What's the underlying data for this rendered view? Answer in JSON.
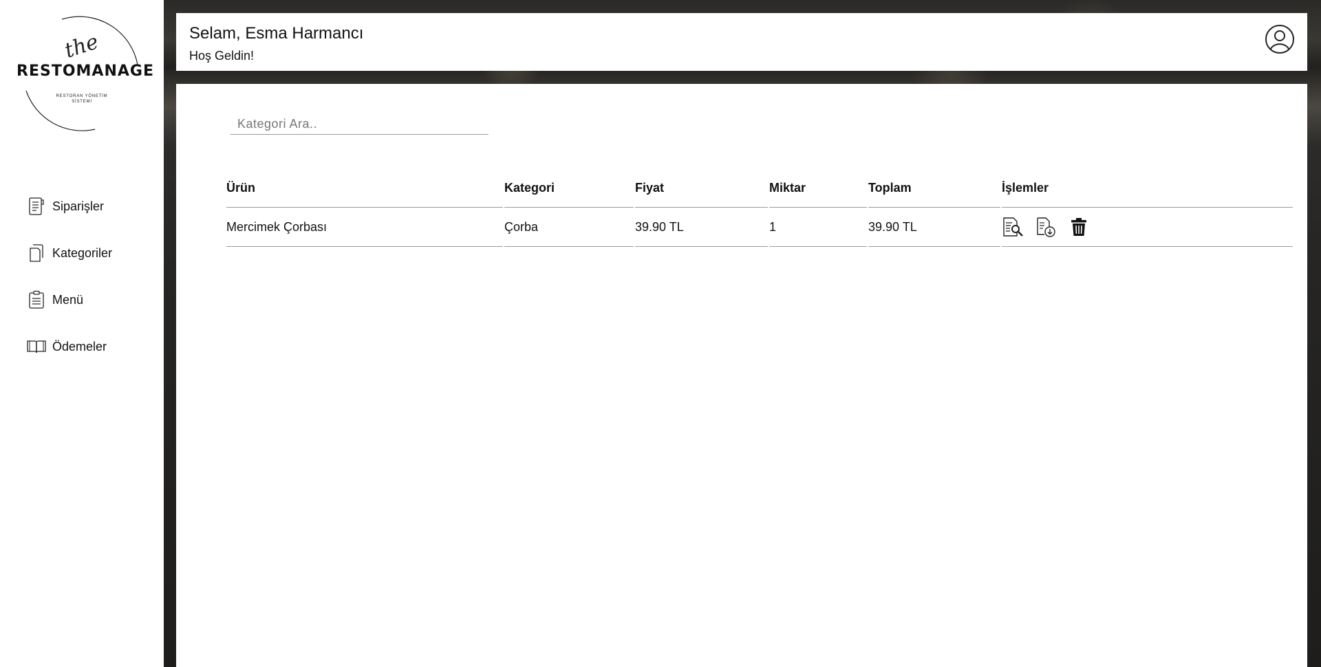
{
  "logo": {
    "script": "the",
    "name": "RESTOMANAGE",
    "subtitle": "RESTORAN YÖNETİM SİSTEMİ"
  },
  "sidebar": {
    "items": [
      {
        "label": "Siparişler",
        "icon": "order-receipt-icon"
      },
      {
        "label": "Kategoriler",
        "icon": "copy-documents-icon"
      },
      {
        "label": "Menü",
        "icon": "clipboard-list-icon"
      },
      {
        "label": "Ödemeler",
        "icon": "open-book-icon"
      }
    ]
  },
  "header": {
    "greeting": "Selam, Esma Harmancı",
    "welcome": "Hoş Geldin!",
    "user_icon": "user-circle-icon"
  },
  "search": {
    "placeholder": "Kategori Ara..",
    "value": ""
  },
  "table": {
    "headers": [
      "Ürün",
      "Kategori",
      "Fiyat",
      "Miktar",
      "Toplam",
      "İşlemler"
    ],
    "rows": [
      {
        "urun": "Mercimek Çorbası",
        "kategori": "Çorba",
        "fiyat": "39.90 TL",
        "miktar": "1",
        "toplam": "39.90 TL",
        "actions": [
          "document-search-icon",
          "document-download-icon",
          "trash-icon"
        ]
      }
    ]
  }
}
